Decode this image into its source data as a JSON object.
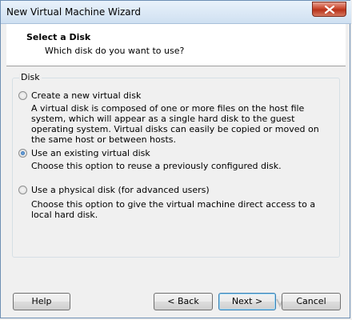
{
  "window": {
    "title": "New Virtual Machine Wizard"
  },
  "header": {
    "title": "Select a Disk",
    "subtitle": "Which disk do you want to use?"
  },
  "group": {
    "legend": "Disk",
    "options": [
      {
        "label": "Create a new virtual disk",
        "selected": false,
        "description": "A virtual disk is composed of one or more files on the host file system, which will appear as a single hard disk to the guest operating system. Virtual disks can easily be copied or moved on the same host or between hosts."
      },
      {
        "label": "Use an existing virtual disk",
        "selected": true,
        "description": "Choose this option to reuse a previously configured disk."
      },
      {
        "label": "Use a physical disk (for advanced users)",
        "selected": false,
        "description": "Choose this option to give the virtual machine direct access to a local hard disk."
      }
    ]
  },
  "buttons": {
    "help": "Help",
    "back": "< Back",
    "next": "Next >",
    "cancel": "Cancel"
  },
  "icons": {
    "close": "close-icon"
  }
}
